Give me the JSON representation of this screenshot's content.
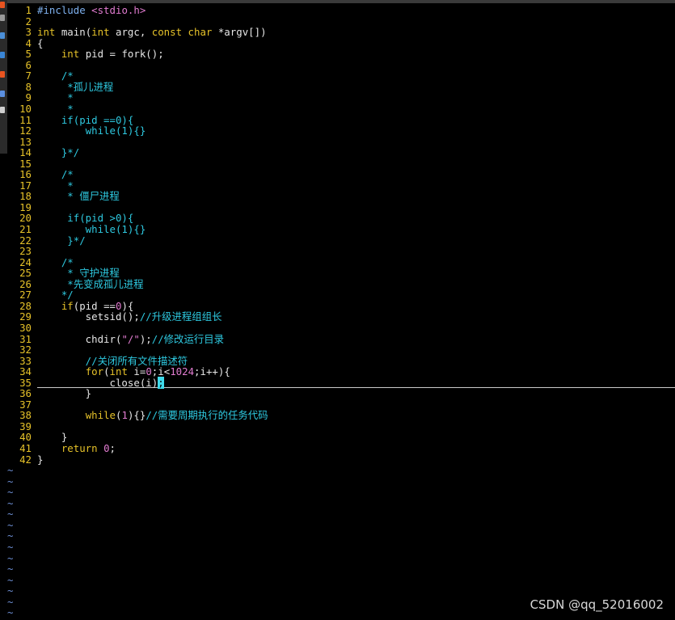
{
  "dock": {
    "icons": [
      {
        "name": "dock-app-icon-1",
        "color": "#e95420"
      },
      {
        "name": "dock-app-icon-2",
        "color": "#9a9a9a"
      },
      {
        "name": "dock-app-icon-3",
        "color": "#4b8fd8"
      },
      {
        "name": "dock-app-icon-4",
        "color": "#3a86d6"
      },
      {
        "name": "dock-app-icon-5",
        "color": "#e95420"
      },
      {
        "name": "dock-app-icon-6",
        "color": "#5b8fe0"
      },
      {
        "name": "dock-app-icon-7",
        "color": "#d0d0d0"
      }
    ]
  },
  "editor": {
    "lines": [
      {
        "n": "1",
        "tokens": [
          {
            "t": "#include ",
            "c": "pre"
          },
          {
            "t": "<stdio.h>",
            "c": "inc"
          }
        ]
      },
      {
        "n": "2",
        "tokens": []
      },
      {
        "n": "3",
        "tokens": [
          {
            "t": "int",
            "c": "kw"
          },
          {
            "t": " main(",
            "c": "default"
          },
          {
            "t": "int",
            "c": "kw"
          },
          {
            "t": " argc, ",
            "c": "default"
          },
          {
            "t": "const",
            "c": "kw"
          },
          {
            "t": " ",
            "c": "default"
          },
          {
            "t": "char",
            "c": "kw"
          },
          {
            "t": " *argv[])",
            "c": "default"
          }
        ]
      },
      {
        "n": "4",
        "tokens": [
          {
            "t": "{",
            "c": "default"
          }
        ]
      },
      {
        "n": "5",
        "tokens": [
          {
            "t": "    ",
            "c": "default"
          },
          {
            "t": "int",
            "c": "kw"
          },
          {
            "t": " pid = fork();",
            "c": "default"
          }
        ]
      },
      {
        "n": "6",
        "tokens": []
      },
      {
        "n": "7",
        "tokens": [
          {
            "t": "    /*",
            "c": "cm"
          }
        ]
      },
      {
        "n": "8",
        "tokens": [
          {
            "t": "     *孤儿进程",
            "c": "cm"
          }
        ]
      },
      {
        "n": "9",
        "tokens": [
          {
            "t": "     *",
            "c": "cm"
          }
        ]
      },
      {
        "n": "10",
        "tokens": [
          {
            "t": "     *",
            "c": "cm"
          }
        ]
      },
      {
        "n": "11",
        "tokens": [
          {
            "t": "    if(pid ==0){",
            "c": "cm"
          }
        ]
      },
      {
        "n": "12",
        "tokens": [
          {
            "t": "        while(1){}",
            "c": "cm"
          }
        ]
      },
      {
        "n": "13",
        "tokens": []
      },
      {
        "n": "14",
        "tokens": [
          {
            "t": "    }*/",
            "c": "cm"
          }
        ]
      },
      {
        "n": "15",
        "tokens": []
      },
      {
        "n": "16",
        "tokens": [
          {
            "t": "    /*",
            "c": "cm"
          }
        ]
      },
      {
        "n": "17",
        "tokens": [
          {
            "t": "     *",
            "c": "cm"
          }
        ]
      },
      {
        "n": "18",
        "tokens": [
          {
            "t": "     * 僵尸进程",
            "c": "cm"
          }
        ]
      },
      {
        "n": "19",
        "tokens": []
      },
      {
        "n": "20",
        "tokens": [
          {
            "t": "     if(pid >0){",
            "c": "cm"
          }
        ]
      },
      {
        "n": "21",
        "tokens": [
          {
            "t": "        while(1){}",
            "c": "cm"
          }
        ]
      },
      {
        "n": "22",
        "tokens": [
          {
            "t": "     }*/",
            "c": "cm"
          }
        ]
      },
      {
        "n": "23",
        "tokens": []
      },
      {
        "n": "24",
        "tokens": [
          {
            "t": "    /*",
            "c": "cm"
          }
        ]
      },
      {
        "n": "25",
        "tokens": [
          {
            "t": "     * 守护进程",
            "c": "cm"
          }
        ]
      },
      {
        "n": "26",
        "tokens": [
          {
            "t": "     *先变成孤儿进程",
            "c": "cm"
          }
        ]
      },
      {
        "n": "27",
        "tokens": [
          {
            "t": "    */",
            "c": "cm"
          }
        ]
      },
      {
        "n": "28",
        "tokens": [
          {
            "t": "    ",
            "c": "default"
          },
          {
            "t": "if",
            "c": "kw"
          },
          {
            "t": "(pid ==",
            "c": "default"
          },
          {
            "t": "0",
            "c": "num"
          },
          {
            "t": "){",
            "c": "default"
          }
        ]
      },
      {
        "n": "29",
        "tokens": [
          {
            "t": "        setsid();",
            "c": "default"
          },
          {
            "t": "//升级进程组组长",
            "c": "cm"
          }
        ]
      },
      {
        "n": "30",
        "tokens": []
      },
      {
        "n": "31",
        "tokens": [
          {
            "t": "        chdir(",
            "c": "default"
          },
          {
            "t": "\"/\"",
            "c": "str"
          },
          {
            "t": ");",
            "c": "default"
          },
          {
            "t": "//修改运行目录",
            "c": "cm"
          }
        ]
      },
      {
        "n": "32",
        "tokens": []
      },
      {
        "n": "33",
        "tokens": [
          {
            "t": "        //关闭所有文件描述符",
            "c": "cm"
          }
        ]
      },
      {
        "n": "34",
        "tokens": [
          {
            "t": "        ",
            "c": "default"
          },
          {
            "t": "for",
            "c": "kw"
          },
          {
            "t": "(",
            "c": "default"
          },
          {
            "t": "int",
            "c": "kw"
          },
          {
            "t": " i=",
            "c": "default"
          },
          {
            "t": "0",
            "c": "num"
          },
          {
            "t": ";i<",
            "c": "default"
          },
          {
            "t": "1024",
            "c": "num"
          },
          {
            "t": ";i++){",
            "c": "default"
          }
        ]
      },
      {
        "n": "35",
        "tokens": [
          {
            "t": "            close(i)",
            "c": "default"
          },
          {
            "t": ";",
            "c": "cursor"
          }
        ]
      },
      {
        "n": "36",
        "tokens": [
          {
            "t": "        }",
            "c": "default"
          }
        ]
      },
      {
        "n": "37",
        "tokens": []
      },
      {
        "n": "38",
        "tokens": [
          {
            "t": "        ",
            "c": "default"
          },
          {
            "t": "while",
            "c": "kw"
          },
          {
            "t": "(",
            "c": "default"
          },
          {
            "t": "1",
            "c": "num"
          },
          {
            "t": "){}",
            "c": "default"
          },
          {
            "t": "//需要周期执行的任务代码",
            "c": "cm"
          }
        ]
      },
      {
        "n": "39",
        "tokens": []
      },
      {
        "n": "40",
        "tokens": [
          {
            "t": "    }",
            "c": "default"
          }
        ]
      },
      {
        "n": "41",
        "tokens": [
          {
            "t": "    ",
            "c": "default"
          },
          {
            "t": "return",
            "c": "kw"
          },
          {
            "t": " ",
            "c": "default"
          },
          {
            "t": "0",
            "c": "num"
          },
          {
            "t": ";",
            "c": "default"
          }
        ]
      },
      {
        "n": "42",
        "tokens": [
          {
            "t": "}",
            "c": "default"
          }
        ]
      }
    ],
    "tilde_char": "~",
    "tilde_count": 14
  },
  "watermark": "CSDN @qq_52016002",
  "colors": {
    "background": "#000000",
    "line_number": "#e6c229",
    "comment": "#2ec9e0",
    "keyword": "#e6c229",
    "constant": "#e27cd1",
    "preproc": "#7fb2f0",
    "tilde": "#6d8fd6",
    "cursor": "#3fd9ea"
  }
}
